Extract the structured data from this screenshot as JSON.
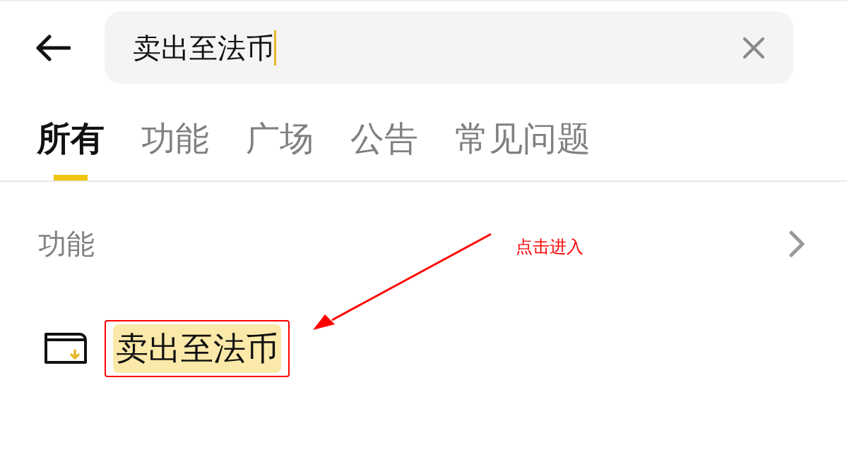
{
  "search": {
    "value": "卖出至法币"
  },
  "tabs": [
    {
      "label": "所有",
      "selected": true
    },
    {
      "label": "功能",
      "selected": false
    },
    {
      "label": "广场",
      "selected": false
    },
    {
      "label": "公告",
      "selected": false
    },
    {
      "label": "常见问题",
      "selected": false
    }
  ],
  "section": {
    "title": "功能"
  },
  "results": [
    {
      "label": "卖出至法币",
      "highlighted": true
    }
  ],
  "annotation": {
    "text": "点击进入"
  }
}
